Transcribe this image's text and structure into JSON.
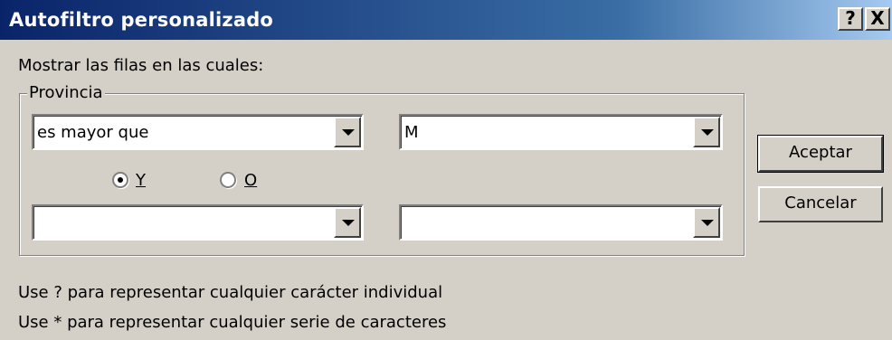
{
  "window": {
    "title": "Autofiltro personalizado",
    "help_label": "?",
    "close_label": "X"
  },
  "instructions": "Mostrar las filas en las cuales:",
  "group": {
    "label": "Provincia",
    "row1": {
      "operator": "es mayor que",
      "value": "M"
    },
    "logic": {
      "and_label": "Y",
      "or_label": "O",
      "selected": "Y"
    },
    "row2": {
      "operator": "",
      "value": ""
    }
  },
  "buttons": {
    "ok": "Aceptar",
    "cancel": "Cancelar"
  },
  "hints": [
    "Use ? para representar cualquier carácter individual",
    "Use * para representar cualquier serie de caracteres"
  ],
  "icons": {
    "combo_arrow": "chevron-down-icon",
    "radio_selected": "radio-selected-icon",
    "radio_unselected": "radio-unselected-icon"
  }
}
